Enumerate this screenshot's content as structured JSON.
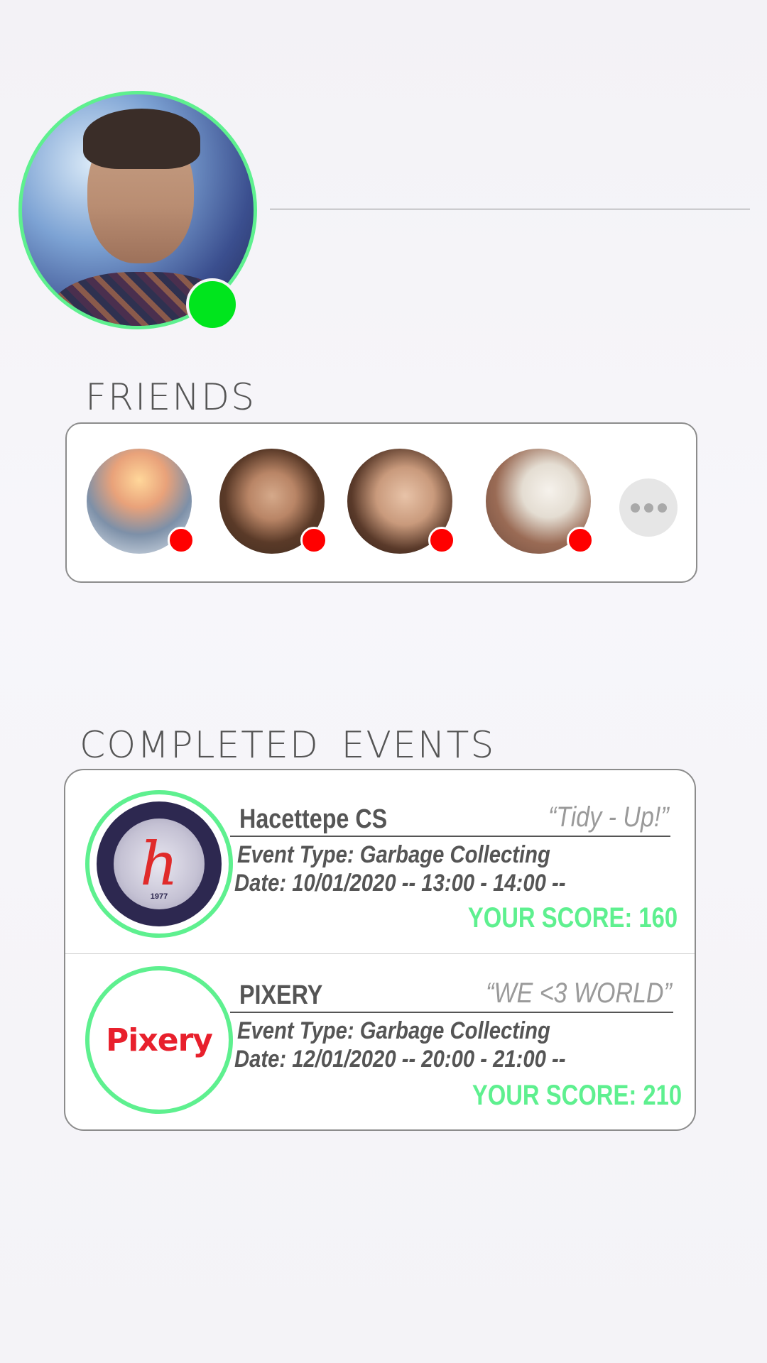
{
  "profile": {
    "status": "online",
    "status_color": "#00e51d",
    "ring_color": "#5ef08f"
  },
  "friends": {
    "title": "FRIENDS",
    "items": [
      {
        "status": "offline"
      },
      {
        "status": "offline"
      },
      {
        "status": "offline"
      },
      {
        "status": "offline"
      }
    ],
    "more_icon": "ellipsis-icon",
    "offline_color": "#ff0000"
  },
  "events": {
    "title": "COMPLETED  EVENTS",
    "items": [
      {
        "name": "Hacettepe CS",
        "slogan": "“Tidy - Up!”",
        "type_line": "Event Type: Garbage Collecting",
        "date_line": "Date: 10/01/2020 -- 13:00 - 14:00 --",
        "score_line": "YOUR SCORE: 160",
        "logo": {
          "seal_year": "1977"
        }
      },
      {
        "name": "PIXERY",
        "slogan": "“WE <3 WORLD”",
        "type_line": "Event Type: Garbage Collecting",
        "date_line": "Date: 12/01/2020 -- 20:00 - 21:00 --",
        "score_line": "YOUR SCORE: 210",
        "logo": {
          "wordmark": "Pixery"
        }
      }
    ],
    "score_color": "#5ef08f"
  }
}
